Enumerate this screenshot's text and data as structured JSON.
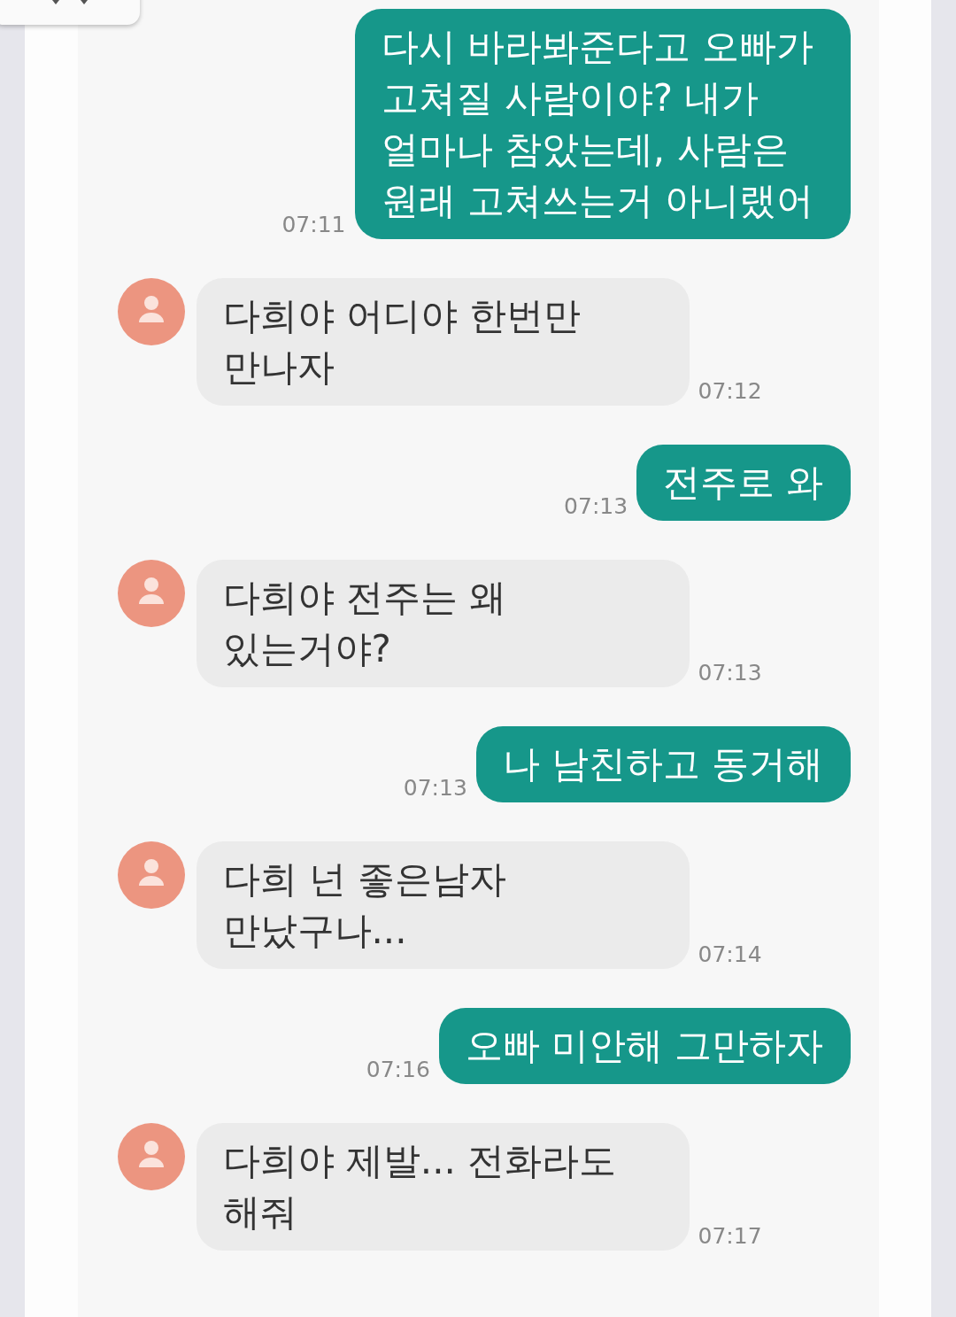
{
  "messages": [
    {
      "kind": "sent",
      "text": "다시 바라봐준다고 오빠가 고쳐질 사람이야? 내가 얼마나 참았는데, 사람은 원래 고쳐쓰는거 아니랬어",
      "time": "07:11"
    },
    {
      "kind": "received",
      "text": "다희야 어디야 한번만 만나자",
      "time": "07:12"
    },
    {
      "kind": "sent",
      "text": "전주로 와",
      "time": "07:13"
    },
    {
      "kind": "received",
      "text": "다희야 전주는 왜 있는거야?",
      "time": "07:13"
    },
    {
      "kind": "sent",
      "text": "나 남친하고 동거해",
      "time": "07:13"
    },
    {
      "kind": "received",
      "text": "다희 넌 좋은남자 만났구나...",
      "time": "07:14"
    },
    {
      "kind": "sent",
      "text": "오빠 미안해 그만하자",
      "time": "07:16"
    },
    {
      "kind": "received",
      "text": "다희야 제발... 전화라도 해줘",
      "time": "07:17"
    }
  ]
}
